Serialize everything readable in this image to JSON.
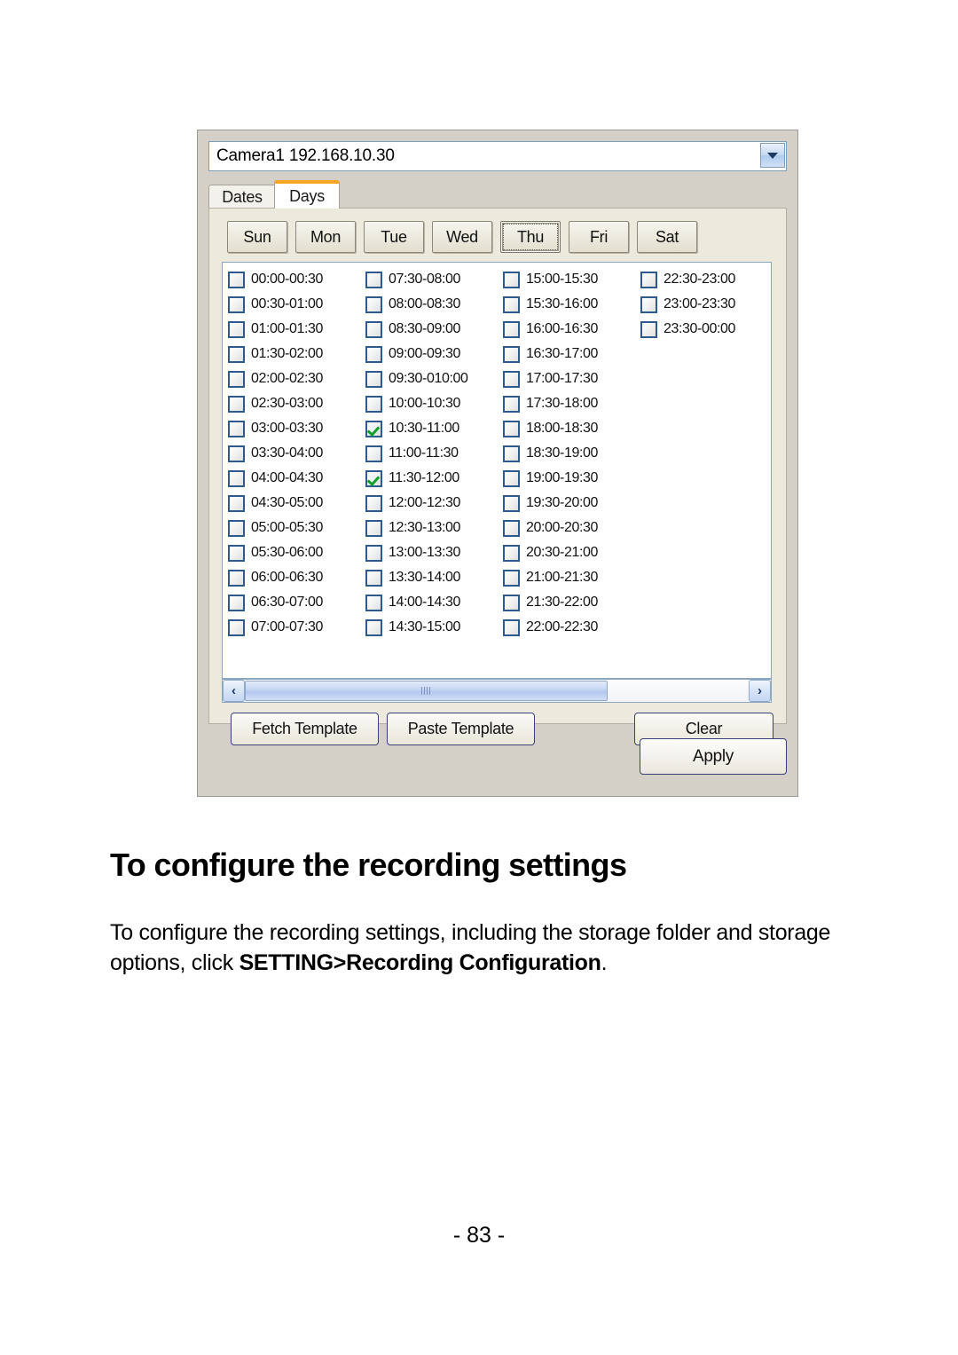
{
  "dialog": {
    "camera_combo": {
      "value": "Camera1 192.168.10.30",
      "arrow_icon": "chevron-down-icon"
    },
    "tabs": [
      {
        "label": "Dates",
        "active": false
      },
      {
        "label": "Days",
        "active": true
      }
    ],
    "weekdays": [
      {
        "label": "Sun",
        "selected": false
      },
      {
        "label": "Mon",
        "selected": false
      },
      {
        "label": "Tue",
        "selected": false
      },
      {
        "label": "Wed",
        "selected": false
      },
      {
        "label": "Thu",
        "selected": true
      },
      {
        "label": "Fri",
        "selected": false
      },
      {
        "label": "Sat",
        "selected": false
      }
    ],
    "time_slot_columns": [
      [
        {
          "label": "00:00-00:30",
          "checked": false
        },
        {
          "label": "00:30-01:00",
          "checked": false
        },
        {
          "label": "01:00-01:30",
          "checked": false
        },
        {
          "label": "01:30-02:00",
          "checked": false
        },
        {
          "label": "02:00-02:30",
          "checked": false
        },
        {
          "label": "02:30-03:00",
          "checked": false
        },
        {
          "label": "03:00-03:30",
          "checked": false
        },
        {
          "label": "03:30-04:00",
          "checked": false
        },
        {
          "label": "04:00-04:30",
          "checked": false
        },
        {
          "label": "04:30-05:00",
          "checked": false
        },
        {
          "label": "05:00-05:30",
          "checked": false
        },
        {
          "label": "05:30-06:00",
          "checked": false
        },
        {
          "label": "06:00-06:30",
          "checked": false
        },
        {
          "label": "06:30-07:00",
          "checked": false
        },
        {
          "label": "07:00-07:30",
          "checked": false
        }
      ],
      [
        {
          "label": "07:30-08:00",
          "checked": false
        },
        {
          "label": "08:00-08:30",
          "checked": false
        },
        {
          "label": "08:30-09:00",
          "checked": false
        },
        {
          "label": "09:00-09:30",
          "checked": false
        },
        {
          "label": "09:30-010:00",
          "checked": false
        },
        {
          "label": "10:00-10:30",
          "checked": false
        },
        {
          "label": "10:30-11:00",
          "checked": true
        },
        {
          "label": "11:00-11:30",
          "checked": false
        },
        {
          "label": "11:30-12:00",
          "checked": true
        },
        {
          "label": "12:00-12:30",
          "checked": false
        },
        {
          "label": "12:30-13:00",
          "checked": false
        },
        {
          "label": "13:00-13:30",
          "checked": false
        },
        {
          "label": "13:30-14:00",
          "checked": false
        },
        {
          "label": "14:00-14:30",
          "checked": false
        },
        {
          "label": "14:30-15:00",
          "checked": false
        }
      ],
      [
        {
          "label": "15:00-15:30",
          "checked": false
        },
        {
          "label": "15:30-16:00",
          "checked": false
        },
        {
          "label": "16:00-16:30",
          "checked": false
        },
        {
          "label": "16:30-17:00",
          "checked": false
        },
        {
          "label": "17:00-17:30",
          "checked": false
        },
        {
          "label": "17:30-18:00",
          "checked": false
        },
        {
          "label": "18:00-18:30",
          "checked": false
        },
        {
          "label": "18:30-19:00",
          "checked": false
        },
        {
          "label": "19:00-19:30",
          "checked": false
        },
        {
          "label": "19:30-20:00",
          "checked": false
        },
        {
          "label": "20:00-20:30",
          "checked": false
        },
        {
          "label": "20:30-21:00",
          "checked": false
        },
        {
          "label": "21:00-21:30",
          "checked": false
        },
        {
          "label": "21:30-22:00",
          "checked": false
        },
        {
          "label": "22:00-22:30",
          "checked": false
        }
      ],
      [
        {
          "label": "22:30-23:00",
          "checked": false
        },
        {
          "label": "23:00-23:30",
          "checked": false
        },
        {
          "label": "23:30-00:00",
          "checked": false
        }
      ]
    ],
    "scrollbar": {
      "left_arrow": "‹",
      "right_arrow": "›",
      "thumb_grip_icon": "grip-icon"
    },
    "buttons": {
      "fetch_template": "Fetch Template",
      "paste_template": "Paste Template",
      "clear": "Clear",
      "apply": "Apply"
    }
  },
  "document": {
    "heading": "To configure the recording settings",
    "paragraph_part1": "To configure the recording settings, including the storage folder and storage options, click ",
    "paragraph_bold": "SETTING>Recording Configuration",
    "paragraph_part2": ".",
    "page_number": "- 83 -"
  }
}
